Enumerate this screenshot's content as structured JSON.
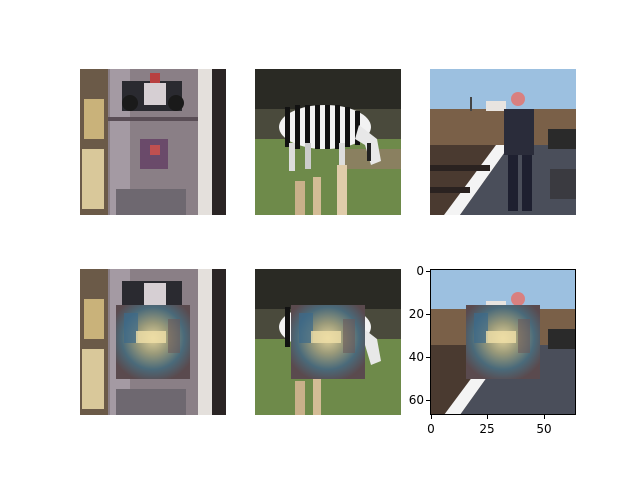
{
  "figure": {
    "panels": [
      {
        "row": 1,
        "col": 1,
        "subject": "refrigerator with magnets",
        "patched": false,
        "has_axes": false
      },
      {
        "row": 1,
        "col": 2,
        "subject": "grazing zebra",
        "patched": false,
        "has_axes": false
      },
      {
        "row": 1,
        "col": 3,
        "subject": "person on train platform",
        "patched": false,
        "has_axes": false
      },
      {
        "row": 2,
        "col": 1,
        "subject": "refrigerator with magnets",
        "patched": true,
        "has_axes": false
      },
      {
        "row": 2,
        "col": 2,
        "subject": "grazing zebra",
        "patched": true,
        "has_axes": false
      },
      {
        "row": 2,
        "col": 3,
        "subject": "person on train platform",
        "patched": true,
        "has_axes": true
      }
    ],
    "axes": {
      "y_ticks": [
        "0",
        "20",
        "40",
        "60"
      ],
      "x_ticks": [
        "0",
        "25",
        "50"
      ],
      "xlim": [
        0,
        64
      ],
      "ylim": [
        64,
        0
      ]
    }
  },
  "colors": {
    "fridge_steel": "#8a7f86",
    "zebra_grass": "#6e8a4a",
    "platform_sky": "#9cc0e0",
    "patch_center": "#d8c690"
  }
}
